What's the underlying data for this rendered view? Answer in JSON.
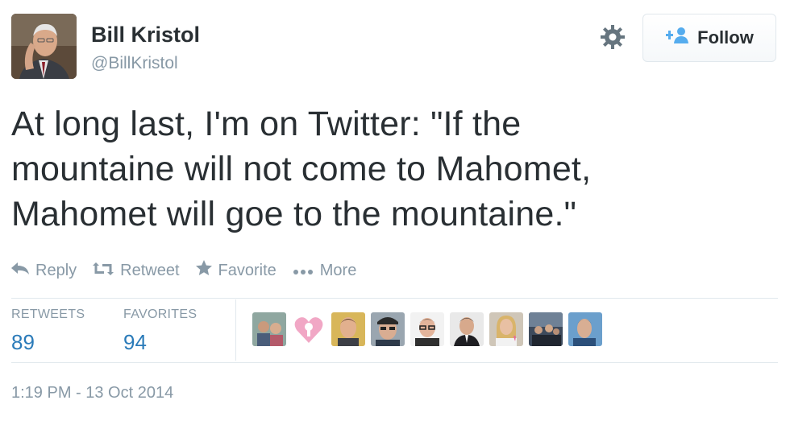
{
  "user": {
    "name": "Bill Kristol",
    "handle": "@BillKristol"
  },
  "follow_button": {
    "label": "Follow"
  },
  "tweet": {
    "lines": [
      "At long last, I'm on Twitter: \"If the",
      "mountaine will not come to Mahomet,",
      "Mahomet will goe to the mountaine.\""
    ]
  },
  "actions": {
    "reply": "Reply",
    "retweet": "Retweet",
    "favorite": "Favorite",
    "more": "More"
  },
  "stats": {
    "retweets_label": "RETWEETS",
    "retweets_value": "89",
    "favorites_label": "FAVORITES",
    "favorites_value": "94"
  },
  "favoriters_count_shown": 9,
  "timestamp": "1:19 PM - 13 Oct 2014",
  "colors": {
    "text": "#292f33",
    "muted": "#8899a6",
    "link_blue": "#2b7bb9",
    "follow_icon_blue": "#55acee",
    "border": "#e1e8ed"
  },
  "icons": [
    "gear-icon",
    "follow-person-icon",
    "reply-icon",
    "retweet-icon",
    "favorite-star-icon",
    "more-dots-icon"
  ]
}
